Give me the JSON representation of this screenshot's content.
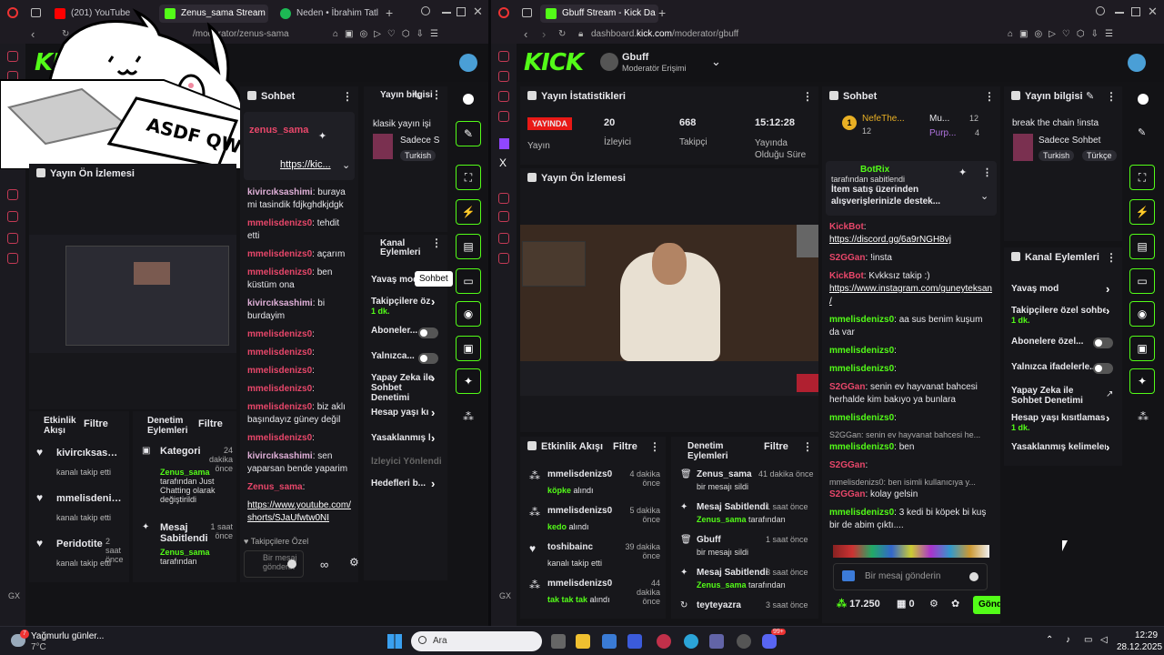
{
  "left_window": {
    "tabs": [
      {
        "label": "(201) YouTube"
      },
      {
        "label": "Zenus_sama Stream - "
      },
      {
        "label": "Neden • İbrahim Tatl"
      }
    ],
    "url": "/moderator/zenus-sama",
    "sticker_text": "ASDF QWER",
    "preview_title": "Yayın Ön İzlemesi",
    "chat": {
      "title": "Sohbet",
      "pinned_user": "zenus_sama",
      "pinned_link": "https://kic...",
      "messages": [
        {
          "user": "kivircıksashimi",
          "text": ": buraya mi tasindik fdjkghdkjdgk"
        },
        {
          "user": "mmelisdenizs0",
          "text": ": tehdit etti"
        },
        {
          "user": "mmelisdenizs0",
          "text": ": açarım"
        },
        {
          "user": "mmelisdenizs0",
          "text": ": ben küstüm ona"
        },
        {
          "user": "kivircıksashimi",
          "text": ": bi burdayim"
        },
        {
          "user": "mmelisdenizs0",
          "text": ":"
        },
        {
          "user": "mmelisdenizs0",
          "text": ":"
        },
        {
          "user": "mmelisdenizs0",
          "text": ":"
        },
        {
          "user": "mmelisdenizs0",
          "text": ":"
        },
        {
          "user": "mmelisdenizs0",
          "text": ": biz aklı başındayız güney değil"
        },
        {
          "user": "mmelisdenizs0",
          "text": ":"
        },
        {
          "user": "kivircıksashimi",
          "text": ": sen yaparsan bende yaparim"
        },
        {
          "user": "Zenus_sama",
          "text": ":"
        }
      ],
      "last_link": "https://www.youtube.com/shorts/SJaUfwtw0NI",
      "followers_only": "Takipçilere Özel",
      "input_placeholder": "Bir mesaj gönderin",
      "tooltip": "Sohbet"
    },
    "stream_info": {
      "title": "Yayın bilgisi",
      "stream_title": "klasik yayın işi",
      "category": "Sadece S",
      "tag": "Turkish"
    },
    "channel_actions": {
      "title": "Kanal Eylemleri",
      "items": [
        {
          "label": "Yavaş mod",
          "sub": ""
        },
        {
          "label": "Takipçilere öz",
          "sub": "1 dk."
        },
        {
          "label": "Aboneler...",
          "sub": ""
        },
        {
          "label": "Yalnızca...",
          "sub": ""
        },
        {
          "label": "Yapay Zeka ile Sohbet Denetimi",
          "sub": ""
        },
        {
          "label": "Hesap yaşı kı",
          "sub": ""
        },
        {
          "label": "Yasaklanmış l",
          "sub": ""
        },
        {
          "label": "İzleyici Yönlendir",
          "sub": ""
        },
        {
          "label": "Hedefleri b...",
          "sub": ""
        }
      ]
    },
    "activity": {
      "title": "Etkinlik Akışı",
      "filter": "Filtre",
      "items": [
        {
          "user": "kivircıksashimi",
          "desc": "kanalı takip etti",
          "time": ""
        },
        {
          "user": "mmelisdenizs0",
          "desc": "kanalı takip etti",
          "time": ""
        },
        {
          "user": "Peridotite",
          "desc": "kanalı takip etti",
          "time": "2 saat önce"
        }
      ]
    },
    "moderation": {
      "title": "Denetim Eylemleri",
      "filter": "Filtre",
      "items": [
        {
          "title": "Kategori",
          "by": "Zenus_sama",
          "desc": "tarafından Just Chatting olarak değiştirildi",
          "time": "24 dakika önce"
        },
        {
          "title": "Mesaj Sabitlendi",
          "by": "Zenus_sama",
          "desc": "tarafından",
          "time": "1 saat önce"
        }
      ]
    }
  },
  "right_window": {
    "tabs": [
      {
        "label": "Gbuff Stream - Kick Da"
      }
    ],
    "url_prefix": "dashboard.",
    "url_host": "kick.com",
    "url_path": "/moderator/gbuff",
    "channel_name": "Gbuff",
    "channel_role": "Moderatör Erişimi",
    "stats": {
      "title": "Yayın İstatistikleri",
      "live_badge": "YAYINDA",
      "live_label": "Yayın",
      "viewers": "20",
      "viewers_label": "İzleyici",
      "followers": "668",
      "followers_label": "Takipçi",
      "uptime": "15:12:28",
      "uptime_label": "Yayında Olduğu Süre"
    },
    "preview_title": "Yayın Ön İzlemesi",
    "activity": {
      "title": "Etkinlik Akışı",
      "filter": "Filtre",
      "items": [
        {
          "user": "mmelisdenizs0",
          "desc": "köpke",
          "suffix": "alındı",
          "time": "4 dakika önce"
        },
        {
          "user": "mmelisdenizs0",
          "desc": "kedo",
          "suffix": "alındı",
          "time": "5 dakika önce"
        },
        {
          "user": "toshibainc",
          "desc": "kanalı takip etti",
          "suffix": "",
          "time": "39 dakika önce"
        },
        {
          "user": "mmelisdenizs0",
          "desc": "tak tak tak",
          "suffix": "alındı",
          "time": "44 dakika önce"
        }
      ]
    },
    "moderation": {
      "title": "Denetim Eylemleri",
      "filter": "Filtre",
      "items": [
        {
          "title": "Zenus_sama",
          "desc": "bir mesajı sildi",
          "by": "",
          "time": "41 dakika önce"
        },
        {
          "title": "Mesaj Sabitlendi",
          "desc": "tarafından",
          "by": "Zenus_sama",
          "time": "1 saat önce"
        },
        {
          "title": "Gbuff",
          "desc": "bir mesajı sildi",
          "by": "",
          "time": "1 saat önce"
        },
        {
          "title": "Mesaj Sabitlendi",
          "desc": "tarafından",
          "by": "Zenus_sama",
          "time": "3 saat önce"
        },
        {
          "title": "teyteyazra",
          "desc": "",
          "by": "",
          "time": "3 saat önce"
        }
      ]
    },
    "chat": {
      "title": "Sohbet",
      "top1_name": "NefeThe...",
      "top1_count": "12",
      "top2_name": "Mu...",
      "top2_count": "12",
      "top3_name": "Purp...",
      "top3_count": "4",
      "pinned_user": "BotRix",
      "pinned_by": "tarafından sabitlendi",
      "pinned_text": "İtem satış üzerinden alışverişlerinizle destek...",
      "messages": [
        {
          "user": "KickBot",
          "text": ":",
          "link": "https://discord.gg/6a9rNGH8vj",
          "reply": ""
        },
        {
          "user": "S2GGan",
          "text": ": !insta",
          "link": "",
          "reply": ""
        },
        {
          "user": "KickBot",
          "text": ": Kvkksız takip :)",
          "link": "https://www.instagram.com/guneyteksan/",
          "reply": ""
        },
        {
          "user": "mmelisdenizs0",
          "text": ": aa sus benim kuşum da var",
          "link": "",
          "reply": ""
        },
        {
          "user": "mmelisdenizs0",
          "text": ":",
          "link": "",
          "reply": ""
        },
        {
          "user": "mmelisdenizs0",
          "text": ":",
          "link": "",
          "reply": ""
        },
        {
          "user": "S2GGan",
          "text": ": senin ev hayvanat bahcesi herhalde kim bakıyo ya bunlara",
          "link": "",
          "reply": ""
        },
        {
          "user": "mmelisdenizs0",
          "text": ":",
          "link": "",
          "reply": ""
        },
        {
          "user": "mmelisdenizs0",
          "text": ": ben",
          "link": "",
          "reply": "S2GGan: senin ev hayvanat bahcesi he..."
        },
        {
          "user": "S2GGan",
          "text": ":",
          "link": "",
          "reply": ""
        },
        {
          "user": "S2GGan",
          "text": ": kolay gelsin",
          "link": "",
          "reply": "mmelisdenizs0: ben isimli kullanıcıya y..."
        },
        {
          "user": "mmelisdenizs0",
          "text": ": 3 kedi bi köpek bi kuş bir de abim çıktı....",
          "link": "",
          "reply": ""
        }
      ],
      "input_placeholder": "Bir mesaj gönderin",
      "points": "17.250",
      "gifts": "0",
      "send_label": "Gönd"
    },
    "stream_info": {
      "title": "Yayın bilgisi",
      "stream_title": "break the chain !insta",
      "category": "Sadece Sohbet",
      "tags": [
        "Turkish",
        "Türkçe"
      ]
    },
    "channel_actions": {
      "title": "Kanal Eylemleri",
      "items": [
        {
          "label": "Yavaş mod",
          "sub": ""
        },
        {
          "label": "Takipçilere özel sohbe",
          "sub": "1 dk."
        },
        {
          "label": "Abonelere özel...",
          "sub": ""
        },
        {
          "label": "Yalnızca ifadelerle...",
          "sub": ""
        },
        {
          "label": "Yapay Zeka ile Sohbet Denetimi",
          "sub": ""
        },
        {
          "label": "Hesap yaşı kısıtlaması",
          "sub": "1 dk."
        },
        {
          "label": "Yasaklanmış kelimeler",
          "sub": ""
        }
      ]
    }
  },
  "taskbar": {
    "weather_title": "Yağmurlu günler...",
    "weather_temp": "7°C",
    "weather_badge": "7",
    "search_placeholder": "Ara",
    "discord_badge": "99+",
    "time": "12:29",
    "date": "28.12.2025"
  },
  "colors": {
    "kick_green": "#53fc18",
    "live_red": "#e91916",
    "bg": "#131316"
  }
}
